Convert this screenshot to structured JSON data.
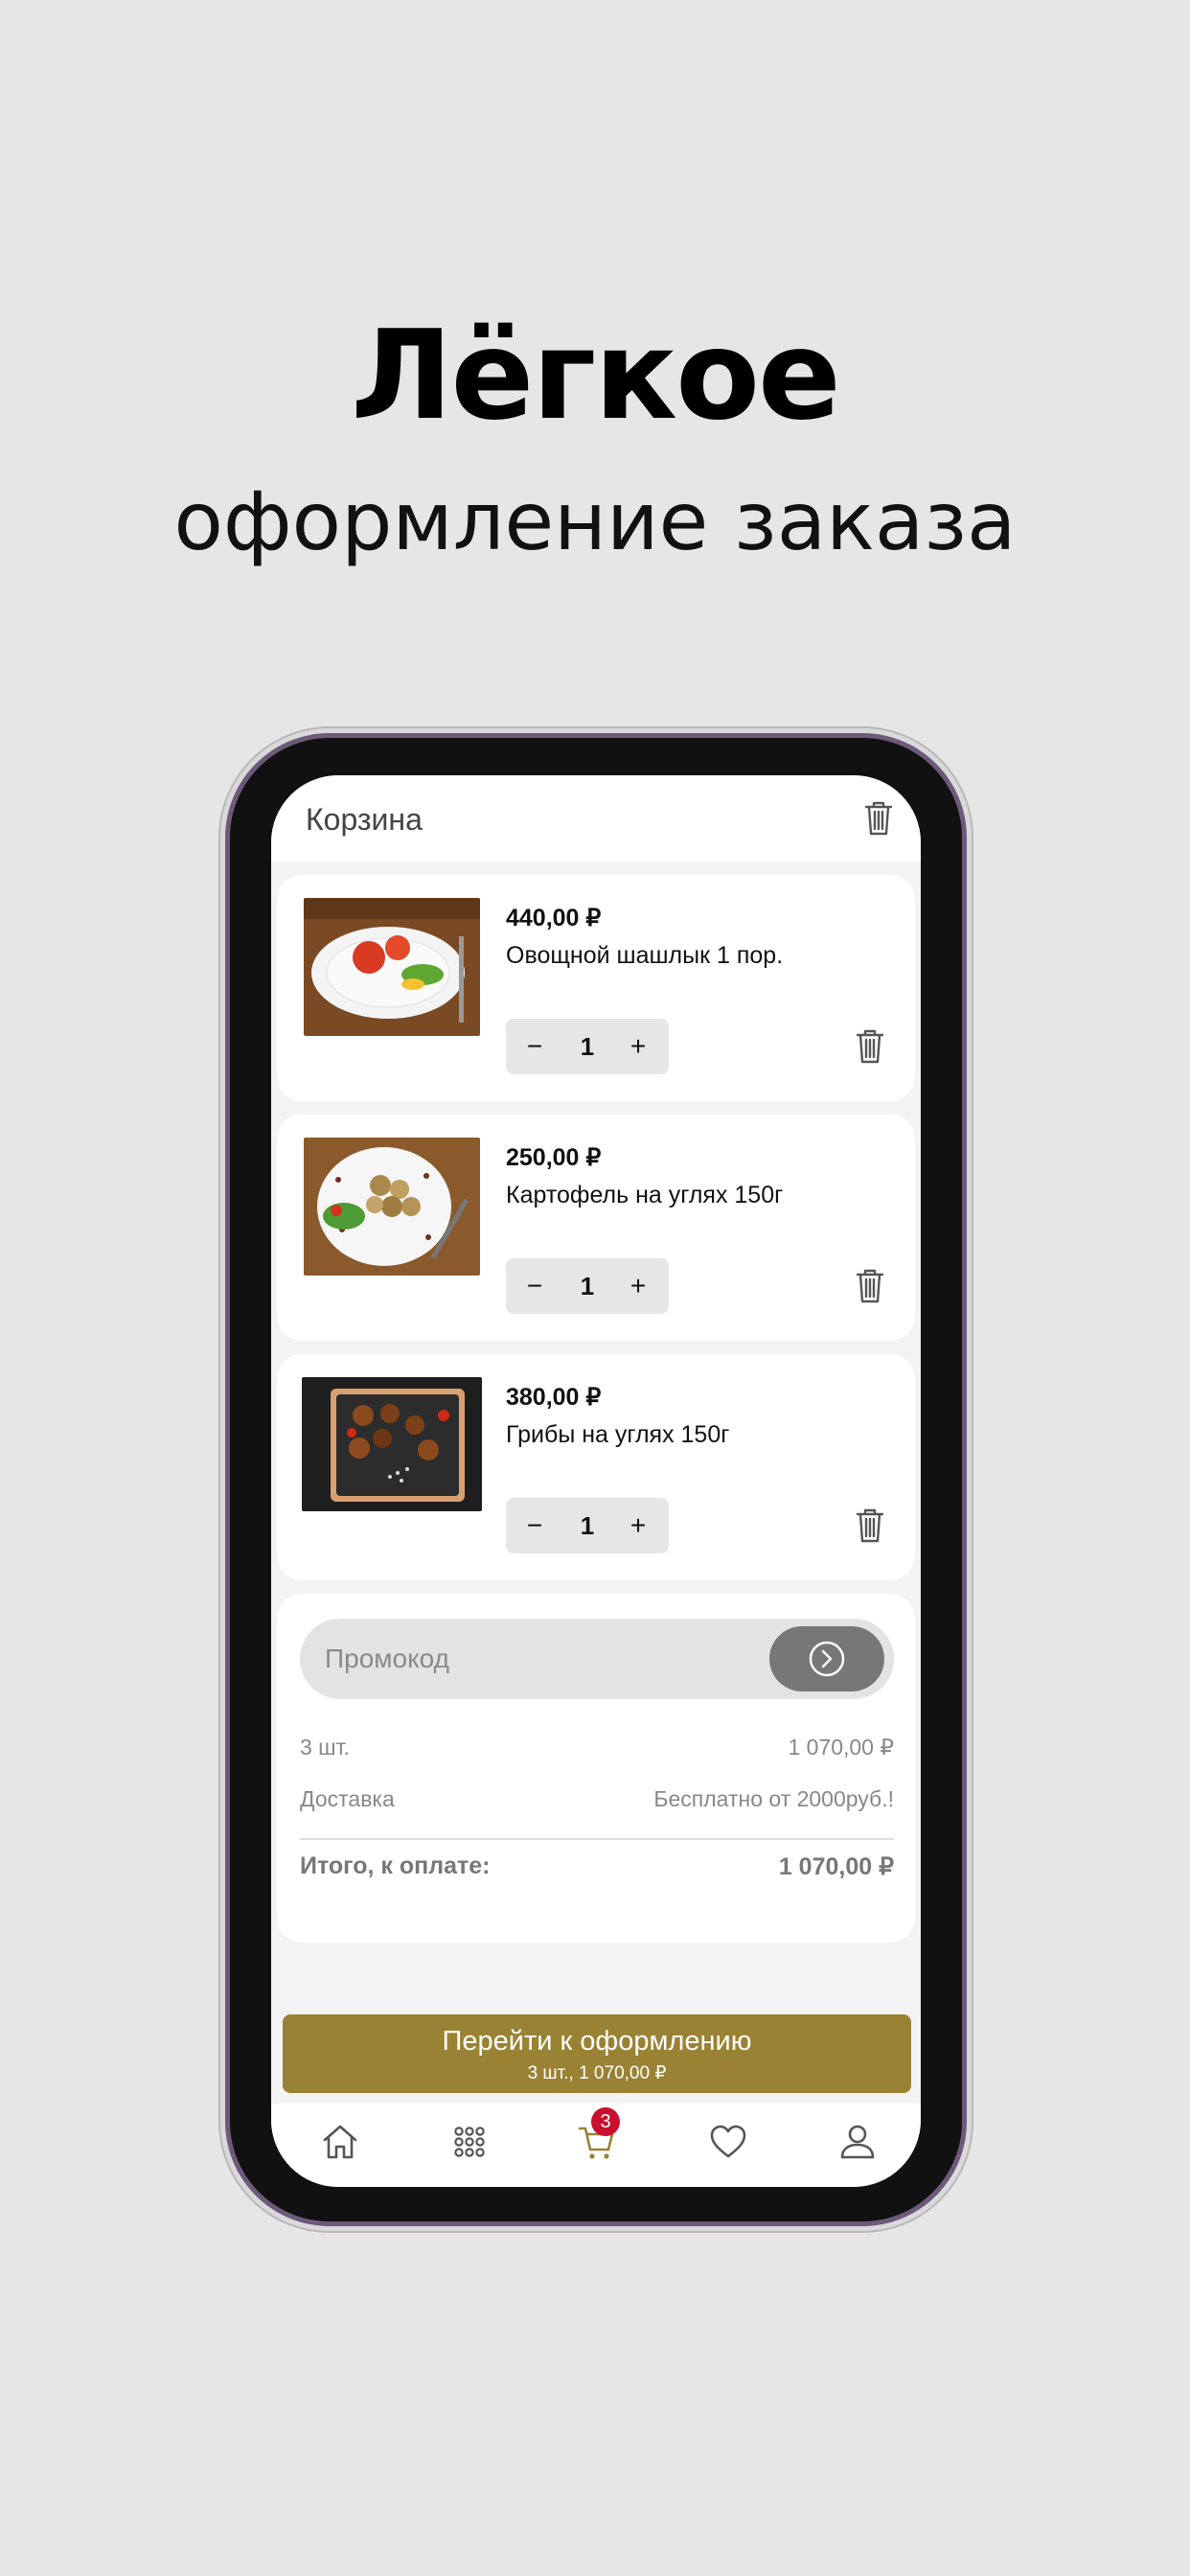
{
  "promo_title": "Лёгкое",
  "promo_subtitle": "оформление заказа",
  "cart": {
    "title": "Корзина",
    "items": [
      {
        "price": "440,00 ₽",
        "name": "Овощной шашлык 1 пор.",
        "qty": "1"
      },
      {
        "price": "250,00 ₽",
        "name": "Картофель на углях 150г",
        "qty": "1"
      },
      {
        "price": "380,00 ₽",
        "name": "Грибы на углях 150г",
        "qty": "1"
      }
    ],
    "stepper": {
      "minus": "−",
      "plus": "+"
    }
  },
  "summary": {
    "promo_placeholder": "Промокод",
    "count_label": "3 шт.",
    "count_value": "1 070,00 ₽",
    "delivery_label": "Доставка",
    "delivery_value": "Бесплатно от 2000руб.!",
    "total_label": "Итого, к оплате:",
    "total_value": "1 070,00 ₽"
  },
  "checkout": {
    "label": "Перейти к оформлению",
    "sub": "3 шт., 1 070,00 ₽"
  },
  "tabbar": {
    "items": [
      "home-icon",
      "catalog-icon",
      "cart-icon",
      "favorites-icon",
      "profile-icon"
    ],
    "cart_badge": "3"
  },
  "colors": {
    "accent": "#9a8234",
    "badge": "#c8102e",
    "background": "#e6e6e6"
  }
}
